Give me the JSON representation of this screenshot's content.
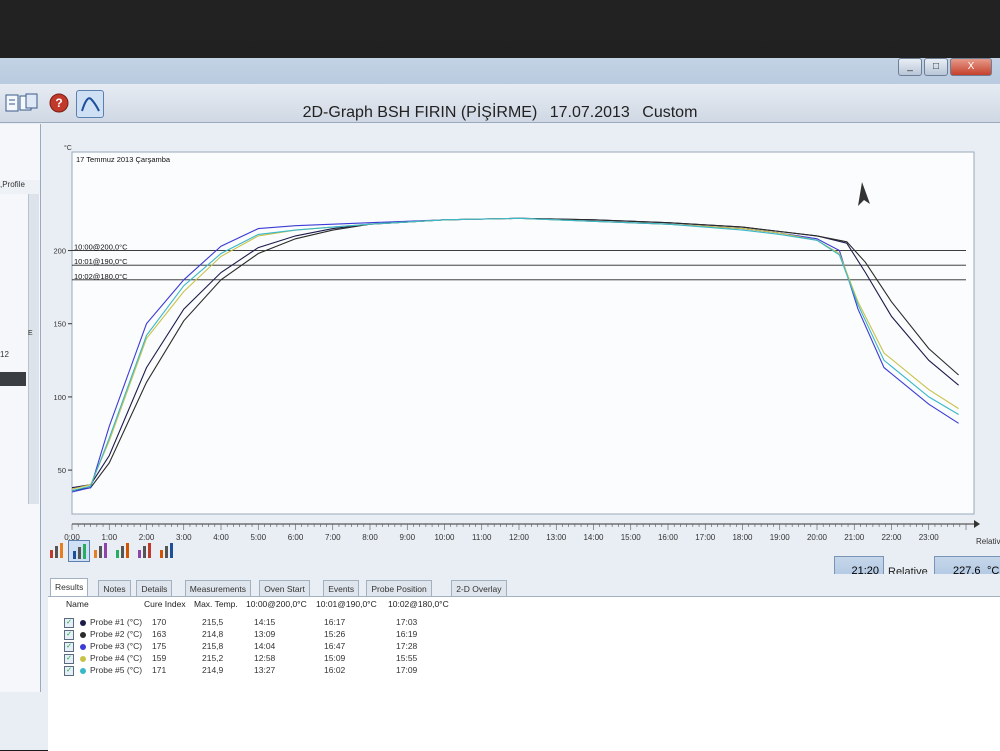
{
  "window": {
    "app_title": "",
    "buttons": {
      "minimize": "_",
      "maximize": "□",
      "close": "X"
    }
  },
  "toolbar": {
    "icons": [
      "document-icon",
      "copy-icon",
      "help-icon",
      "graph-icon"
    ],
    "help_symbol": "?"
  },
  "left_panel": {
    "header": ",Profile",
    "number": "12",
    "marker": "E"
  },
  "graph": {
    "title_parts": [
      "2D-Graph BSH FIRIN (PİŞİRME)",
      "17.07.2013",
      "Custom"
    ],
    "date_label": "17 Temmuz 2013 Çarşamba",
    "y_unit": "°C",
    "x_unit": "Relative",
    "reference_lines": [
      "10:00@200,0°C",
      "10:01@190,0°C",
      "10:02@180,0°C"
    ],
    "view_icons": [
      "bar-chart-icon",
      "line-graph-icon",
      "histogram-icon",
      "trend-icon",
      "pie-icon",
      "multi-bar-icon"
    ]
  },
  "chart_data": {
    "type": "line",
    "x_range": [
      0,
      24
    ],
    "x_ticks": [
      "0:00",
      "1:00",
      "2:00",
      "3:00",
      "4:00",
      "5:00",
      "6:00",
      "7:00",
      "8:00",
      "9:00",
      "10:00",
      "11:00",
      "12:00",
      "13:00",
      "14:00",
      "15:00",
      "16:00",
      "17:00",
      "18:00",
      "19:00",
      "20:00",
      "21:00",
      "22:00",
      "23:00"
    ],
    "y_range": [
      20,
      240
    ],
    "y_ticks": [
      50,
      100,
      150,
      200
    ],
    "reference_values": [
      200,
      190,
      180
    ],
    "series": [
      {
        "name": "Probe #1 (°C)",
        "color": "#1c1c4a",
        "x": [
          0,
          0.5,
          1,
          2,
          3,
          4,
          5,
          6,
          7,
          8,
          10,
          12,
          14,
          16,
          18,
          19,
          20,
          20.8,
          21.3,
          22,
          23,
          23.8
        ],
        "y": [
          38,
          40,
          60,
          120,
          160,
          185,
          202,
          210,
          215,
          218,
          221,
          222,
          221,
          219,
          216,
          213,
          210,
          205,
          185,
          155,
          125,
          108
        ]
      },
      {
        "name": "Probe #2 (°C)",
        "color": "#2b2b2b",
        "x": [
          0,
          0.5,
          1,
          2,
          3,
          4,
          5,
          6,
          7,
          8,
          10,
          12,
          14,
          16,
          18,
          19,
          20,
          20.8,
          21.3,
          22,
          23,
          23.8
        ],
        "y": [
          36,
          38,
          55,
          110,
          152,
          180,
          198,
          208,
          214,
          218,
          221,
          222,
          221,
          219,
          216,
          213,
          210,
          206,
          192,
          165,
          133,
          115
        ]
      },
      {
        "name": "Probe #3 (°C)",
        "color": "#3b3bd6",
        "x": [
          0,
          0.5,
          1,
          2,
          3,
          4,
          5,
          6,
          7,
          8,
          10,
          12,
          14,
          16,
          18,
          19,
          20,
          20.6,
          21.1,
          21.8,
          23,
          23.8
        ],
        "y": [
          35,
          38,
          80,
          150,
          180,
          203,
          215,
          217,
          218,
          219,
          221,
          222,
          220,
          218,
          215,
          212,
          208,
          200,
          160,
          120,
          95,
          82
        ]
      },
      {
        "name": "Probe #4 (°C)",
        "color": "#c9c24a",
        "x": [
          0,
          0.5,
          1,
          2,
          3,
          4,
          5,
          6,
          7,
          8,
          10,
          12,
          14,
          16,
          18,
          19,
          20,
          20.6,
          21.1,
          21.8,
          23,
          23.8
        ],
        "y": [
          37,
          40,
          70,
          140,
          172,
          196,
          210,
          214,
          216,
          218,
          221,
          222,
          220,
          218,
          215,
          212,
          207,
          198,
          165,
          130,
          105,
          92
        ]
      },
      {
        "name": "Probe #5 (°C)",
        "color": "#38b8c8",
        "x": [
          0,
          0.5,
          1,
          2,
          3,
          4,
          5,
          6,
          7,
          8,
          10,
          12,
          14,
          16,
          18,
          19,
          20,
          20.6,
          21.1,
          21.8,
          23,
          23.8
        ],
        "y": [
          36,
          39,
          72,
          142,
          176,
          198,
          211,
          214,
          216,
          218,
          221,
          222,
          220,
          218,
          214,
          211,
          207,
          197,
          163,
          125,
          100,
          88
        ]
      }
    ]
  },
  "controls": {
    "time_value": "21:20",
    "mode_label": "Relative",
    "temp_value": "227,6",
    "temp_unit": "°C"
  },
  "tabs": [
    "Results",
    "Notes",
    "Details",
    "Measurements",
    "Oven Start",
    "Events",
    "Probe Position",
    "2-D Overlay"
  ],
  "results": {
    "headers": [
      "Name",
      "Cure Index",
      "Max. Temp.",
      "10:00@200,0°C",
      "10:01@190,0°C",
      "10:02@180,0°C"
    ],
    "rows": [
      {
        "name": "Probe #1 (°C)",
        "cure": "170",
        "max": "215,5",
        "t1": "14:15",
        "t2": "16:17",
        "t3": "17:03",
        "color": "#1c1c4a"
      },
      {
        "name": "Probe #2 (°C)",
        "cure": "163",
        "max": "214,8",
        "t1": "13:09",
        "t2": "15:26",
        "t3": "16:19",
        "color": "#2b2b2b"
      },
      {
        "name": "Probe #3 (°C)",
        "cure": "175",
        "max": "215,8",
        "t1": "14:04",
        "t2": "16:47",
        "t3": "17:28",
        "color": "#3b3bd6"
      },
      {
        "name": "Probe #4 (°C)",
        "cure": "159",
        "max": "215,2",
        "t1": "12:58",
        "t2": "15:09",
        "t3": "15:55",
        "color": "#c9c24a"
      },
      {
        "name": "Probe #5 (°C)",
        "cure": "171",
        "max": "214,9",
        "t1": "13:27",
        "t2": "16:02",
        "t3": "17:09",
        "color": "#38b8c8"
      }
    ]
  }
}
